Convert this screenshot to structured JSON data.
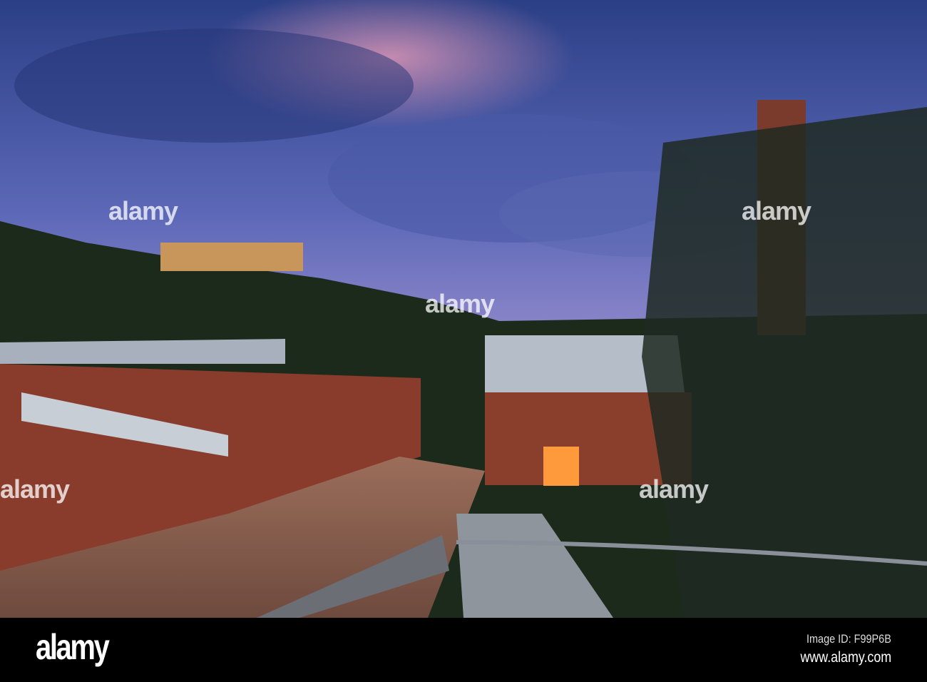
{
  "watermark": "alamy",
  "footer": {
    "logo": "alamy",
    "image_id": "Image ID: F99P6B",
    "url": "www.alamy.com"
  }
}
